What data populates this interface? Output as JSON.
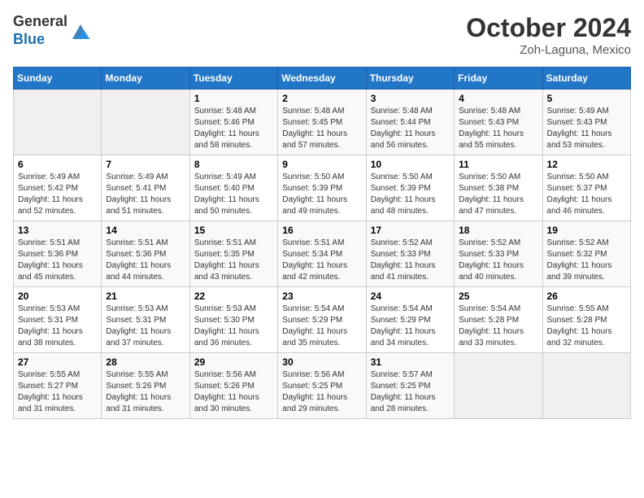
{
  "logo": {
    "general": "General",
    "blue": "Blue"
  },
  "title": "October 2024",
  "location": "Zoh-Laguna, Mexico",
  "days_header": [
    "Sunday",
    "Monday",
    "Tuesday",
    "Wednesday",
    "Thursday",
    "Friday",
    "Saturday"
  ],
  "weeks": [
    [
      {
        "num": "",
        "sunrise": "",
        "sunset": "",
        "daylight": ""
      },
      {
        "num": "",
        "sunrise": "",
        "sunset": "",
        "daylight": ""
      },
      {
        "num": "1",
        "sunrise": "Sunrise: 5:48 AM",
        "sunset": "Sunset: 5:46 PM",
        "daylight": "Daylight: 11 hours and 58 minutes."
      },
      {
        "num": "2",
        "sunrise": "Sunrise: 5:48 AM",
        "sunset": "Sunset: 5:45 PM",
        "daylight": "Daylight: 11 hours and 57 minutes."
      },
      {
        "num": "3",
        "sunrise": "Sunrise: 5:48 AM",
        "sunset": "Sunset: 5:44 PM",
        "daylight": "Daylight: 11 hours and 56 minutes."
      },
      {
        "num": "4",
        "sunrise": "Sunrise: 5:48 AM",
        "sunset": "Sunset: 5:43 PM",
        "daylight": "Daylight: 11 hours and 55 minutes."
      },
      {
        "num": "5",
        "sunrise": "Sunrise: 5:49 AM",
        "sunset": "Sunset: 5:43 PM",
        "daylight": "Daylight: 11 hours and 53 minutes."
      }
    ],
    [
      {
        "num": "6",
        "sunrise": "Sunrise: 5:49 AM",
        "sunset": "Sunset: 5:42 PM",
        "daylight": "Daylight: 11 hours and 52 minutes."
      },
      {
        "num": "7",
        "sunrise": "Sunrise: 5:49 AM",
        "sunset": "Sunset: 5:41 PM",
        "daylight": "Daylight: 11 hours and 51 minutes."
      },
      {
        "num": "8",
        "sunrise": "Sunrise: 5:49 AM",
        "sunset": "Sunset: 5:40 PM",
        "daylight": "Daylight: 11 hours and 50 minutes."
      },
      {
        "num": "9",
        "sunrise": "Sunrise: 5:50 AM",
        "sunset": "Sunset: 5:39 PM",
        "daylight": "Daylight: 11 hours and 49 minutes."
      },
      {
        "num": "10",
        "sunrise": "Sunrise: 5:50 AM",
        "sunset": "Sunset: 5:39 PM",
        "daylight": "Daylight: 11 hours and 48 minutes."
      },
      {
        "num": "11",
        "sunrise": "Sunrise: 5:50 AM",
        "sunset": "Sunset: 5:38 PM",
        "daylight": "Daylight: 11 hours and 47 minutes."
      },
      {
        "num": "12",
        "sunrise": "Sunrise: 5:50 AM",
        "sunset": "Sunset: 5:37 PM",
        "daylight": "Daylight: 11 hours and 46 minutes."
      }
    ],
    [
      {
        "num": "13",
        "sunrise": "Sunrise: 5:51 AM",
        "sunset": "Sunset: 5:36 PM",
        "daylight": "Daylight: 11 hours and 45 minutes."
      },
      {
        "num": "14",
        "sunrise": "Sunrise: 5:51 AM",
        "sunset": "Sunset: 5:36 PM",
        "daylight": "Daylight: 11 hours and 44 minutes."
      },
      {
        "num": "15",
        "sunrise": "Sunrise: 5:51 AM",
        "sunset": "Sunset: 5:35 PM",
        "daylight": "Daylight: 11 hours and 43 minutes."
      },
      {
        "num": "16",
        "sunrise": "Sunrise: 5:51 AM",
        "sunset": "Sunset: 5:34 PM",
        "daylight": "Daylight: 11 hours and 42 minutes."
      },
      {
        "num": "17",
        "sunrise": "Sunrise: 5:52 AM",
        "sunset": "Sunset: 5:33 PM",
        "daylight": "Daylight: 11 hours and 41 minutes."
      },
      {
        "num": "18",
        "sunrise": "Sunrise: 5:52 AM",
        "sunset": "Sunset: 5:33 PM",
        "daylight": "Daylight: 11 hours and 40 minutes."
      },
      {
        "num": "19",
        "sunrise": "Sunrise: 5:52 AM",
        "sunset": "Sunset: 5:32 PM",
        "daylight": "Daylight: 11 hours and 39 minutes."
      }
    ],
    [
      {
        "num": "20",
        "sunrise": "Sunrise: 5:53 AM",
        "sunset": "Sunset: 5:31 PM",
        "daylight": "Daylight: 11 hours and 38 minutes."
      },
      {
        "num": "21",
        "sunrise": "Sunrise: 5:53 AM",
        "sunset": "Sunset: 5:31 PM",
        "daylight": "Daylight: 11 hours and 37 minutes."
      },
      {
        "num": "22",
        "sunrise": "Sunrise: 5:53 AM",
        "sunset": "Sunset: 5:30 PM",
        "daylight": "Daylight: 11 hours and 36 minutes."
      },
      {
        "num": "23",
        "sunrise": "Sunrise: 5:54 AM",
        "sunset": "Sunset: 5:29 PM",
        "daylight": "Daylight: 11 hours and 35 minutes."
      },
      {
        "num": "24",
        "sunrise": "Sunrise: 5:54 AM",
        "sunset": "Sunset: 5:29 PM",
        "daylight": "Daylight: 11 hours and 34 minutes."
      },
      {
        "num": "25",
        "sunrise": "Sunrise: 5:54 AM",
        "sunset": "Sunset: 5:28 PM",
        "daylight": "Daylight: 11 hours and 33 minutes."
      },
      {
        "num": "26",
        "sunrise": "Sunrise: 5:55 AM",
        "sunset": "Sunset: 5:28 PM",
        "daylight": "Daylight: 11 hours and 32 minutes."
      }
    ],
    [
      {
        "num": "27",
        "sunrise": "Sunrise: 5:55 AM",
        "sunset": "Sunset: 5:27 PM",
        "daylight": "Daylight: 11 hours and 31 minutes."
      },
      {
        "num": "28",
        "sunrise": "Sunrise: 5:55 AM",
        "sunset": "Sunset: 5:26 PM",
        "daylight": "Daylight: 11 hours and 31 minutes."
      },
      {
        "num": "29",
        "sunrise": "Sunrise: 5:56 AM",
        "sunset": "Sunset: 5:26 PM",
        "daylight": "Daylight: 11 hours and 30 minutes."
      },
      {
        "num": "30",
        "sunrise": "Sunrise: 5:56 AM",
        "sunset": "Sunset: 5:25 PM",
        "daylight": "Daylight: 11 hours and 29 minutes."
      },
      {
        "num": "31",
        "sunrise": "Sunrise: 5:57 AM",
        "sunset": "Sunset: 5:25 PM",
        "daylight": "Daylight: 11 hours and 28 minutes."
      },
      {
        "num": "",
        "sunrise": "",
        "sunset": "",
        "daylight": ""
      },
      {
        "num": "",
        "sunrise": "",
        "sunset": "",
        "daylight": ""
      }
    ]
  ]
}
